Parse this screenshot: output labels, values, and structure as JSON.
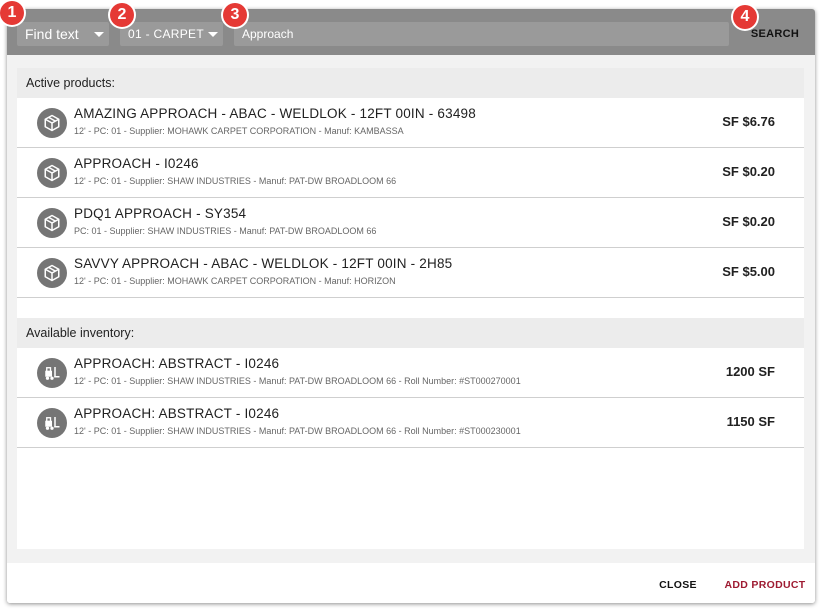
{
  "toolbar": {
    "find_dropdown": "Find text",
    "category_dropdown": "01 - CARPET",
    "search_value": "Approach",
    "search_button": "SEARCH"
  },
  "callouts": [
    "1",
    "2",
    "3",
    "4"
  ],
  "active_products": {
    "header": "Active products:",
    "items": [
      {
        "title": "AMAZING APPROACH - ABAC - WELDLOK - 12FT 00IN - 63498",
        "subtitle": "12' - PC: 01 - Supplier: MOHAWK CARPET CORPORATION - Manuf: KAMBASSA",
        "price": "SF $6.76",
        "icon": "box-icon"
      },
      {
        "title": "APPROACH - I0246",
        "subtitle": "12' - PC: 01 - Supplier: SHAW INDUSTRIES - Manuf: PAT-DW BROADLOOM 66",
        "price": "SF $0.20",
        "icon": "box-icon"
      },
      {
        "title": "PDQ1 APPROACH - SY354",
        "subtitle": "PC: 01 - Supplier: SHAW INDUSTRIES - Manuf: PAT-DW BROADLOOM 66",
        "price": "SF $0.20",
        "icon": "box-icon"
      },
      {
        "title": "SAVVY APPROACH - ABAC - WELDLOK - 12FT 00IN - 2H85",
        "subtitle": "12' - PC: 01 - Supplier: MOHAWK CARPET CORPORATION - Manuf: HORIZON",
        "price": "SF $5.00",
        "icon": "box-icon"
      }
    ]
  },
  "available_inventory": {
    "header": "Available inventory:",
    "items": [
      {
        "title": "APPROACH: ABSTRACT - I0246",
        "subtitle": "12' - PC: 01 - Supplier: SHAW INDUSTRIES - Manuf: PAT-DW BROADLOOM 66 - Roll Number: #ST000270001",
        "quantity": "1200 SF",
        "icon": "forklift-icon"
      },
      {
        "title": "APPROACH: ABSTRACT - I0246",
        "subtitle": "12' - PC: 01 - Supplier: SHAW INDUSTRIES - Manuf: PAT-DW BROADLOOM 66 - Roll Number: #ST000230001",
        "quantity": "1150 SF",
        "icon": "forklift-icon"
      }
    ]
  },
  "footer": {
    "close_button": "CLOSE",
    "add_button": "ADD PRODUCT"
  },
  "colors": {
    "toolbar": "#8a8a8a",
    "callout": "#e53935",
    "add_button": "#9e1b32"
  }
}
